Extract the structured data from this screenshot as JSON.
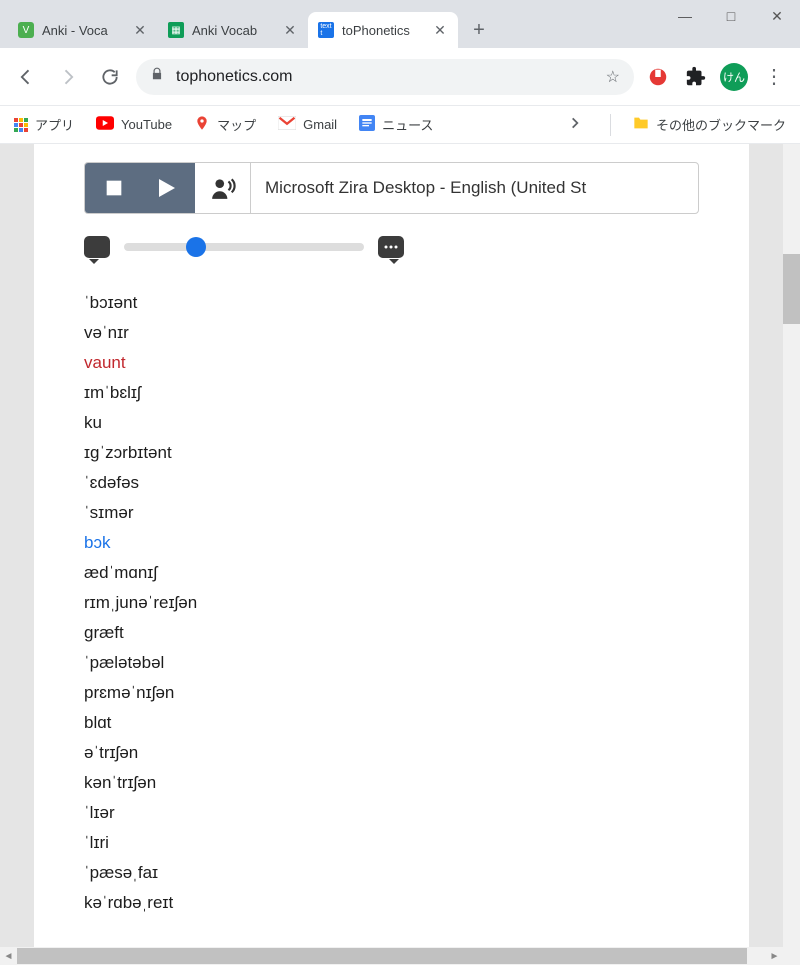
{
  "window": {
    "minimize": "—",
    "maximize": "□",
    "close": "✕"
  },
  "tabs": [
    {
      "title": "Anki - Voca",
      "favicon_bg": "#4caf50",
      "favicon_text": "V",
      "active": false
    },
    {
      "title": "Anki Vocab",
      "favicon_bg": "#0f9d58",
      "favicon_text": "▦",
      "active": false
    },
    {
      "title": "toPhonetics",
      "favicon_bg": "#1a73e8",
      "favicon_text": "txt",
      "active": true
    }
  ],
  "toolbar": {
    "back": "←",
    "forward": "→",
    "reload": "⟳",
    "url": "tophonetics.com",
    "star": "☆",
    "avatar_text": "けん",
    "menu": "⋮"
  },
  "bookmarks": {
    "apps": "アプリ",
    "youtube": "YouTube",
    "maps": "マップ",
    "gmail": "Gmail",
    "news": "ニュース",
    "chevron": "›",
    "other": "その他のブックマーク"
  },
  "player": {
    "voice_label": "Microsoft Zira Desktop - English (United St"
  },
  "slider": {
    "position_pct": 30
  },
  "phonetics": [
    {
      "text": "ˈbɔɪənt",
      "style": "normal"
    },
    {
      "text": "vəˈnɪr",
      "style": "normal"
    },
    {
      "text": "vaunt",
      "style": "red"
    },
    {
      "text": "ɪmˈbɛlɪʃ",
      "style": "normal"
    },
    {
      "text": "ku",
      "style": "normal"
    },
    {
      "text": "ɪgˈzɔrbɪtənt",
      "style": "normal"
    },
    {
      "text": "ˈɛdəfəs",
      "style": "normal"
    },
    {
      "text": "ˈsɪmər",
      "style": "normal"
    },
    {
      "text": "bɔk",
      "style": "blue"
    },
    {
      "text": "ædˈmɑnɪʃ",
      "style": "normal"
    },
    {
      "text": "rɪmˌjunəˈreɪʃən",
      "style": "normal"
    },
    {
      "text": "græft",
      "style": "normal"
    },
    {
      "text": "ˈpælətəbəl",
      "style": "normal"
    },
    {
      "text": "prɛməˈnɪʃən",
      "style": "normal"
    },
    {
      "text": "blɑt",
      "style": "normal"
    },
    {
      "text": "əˈtrɪʃən",
      "style": "normal"
    },
    {
      "text": "kənˈtrɪʃən",
      "style": "normal"
    },
    {
      "text": "ˈlɪər",
      "style": "normal"
    },
    {
      "text": "ˈlɪri",
      "style": "normal"
    },
    {
      "text": "ˈpæsəˌfaɪ",
      "style": "normal"
    },
    {
      "text": "kəˈrɑbəˌreɪt",
      "style": "normal"
    }
  ]
}
